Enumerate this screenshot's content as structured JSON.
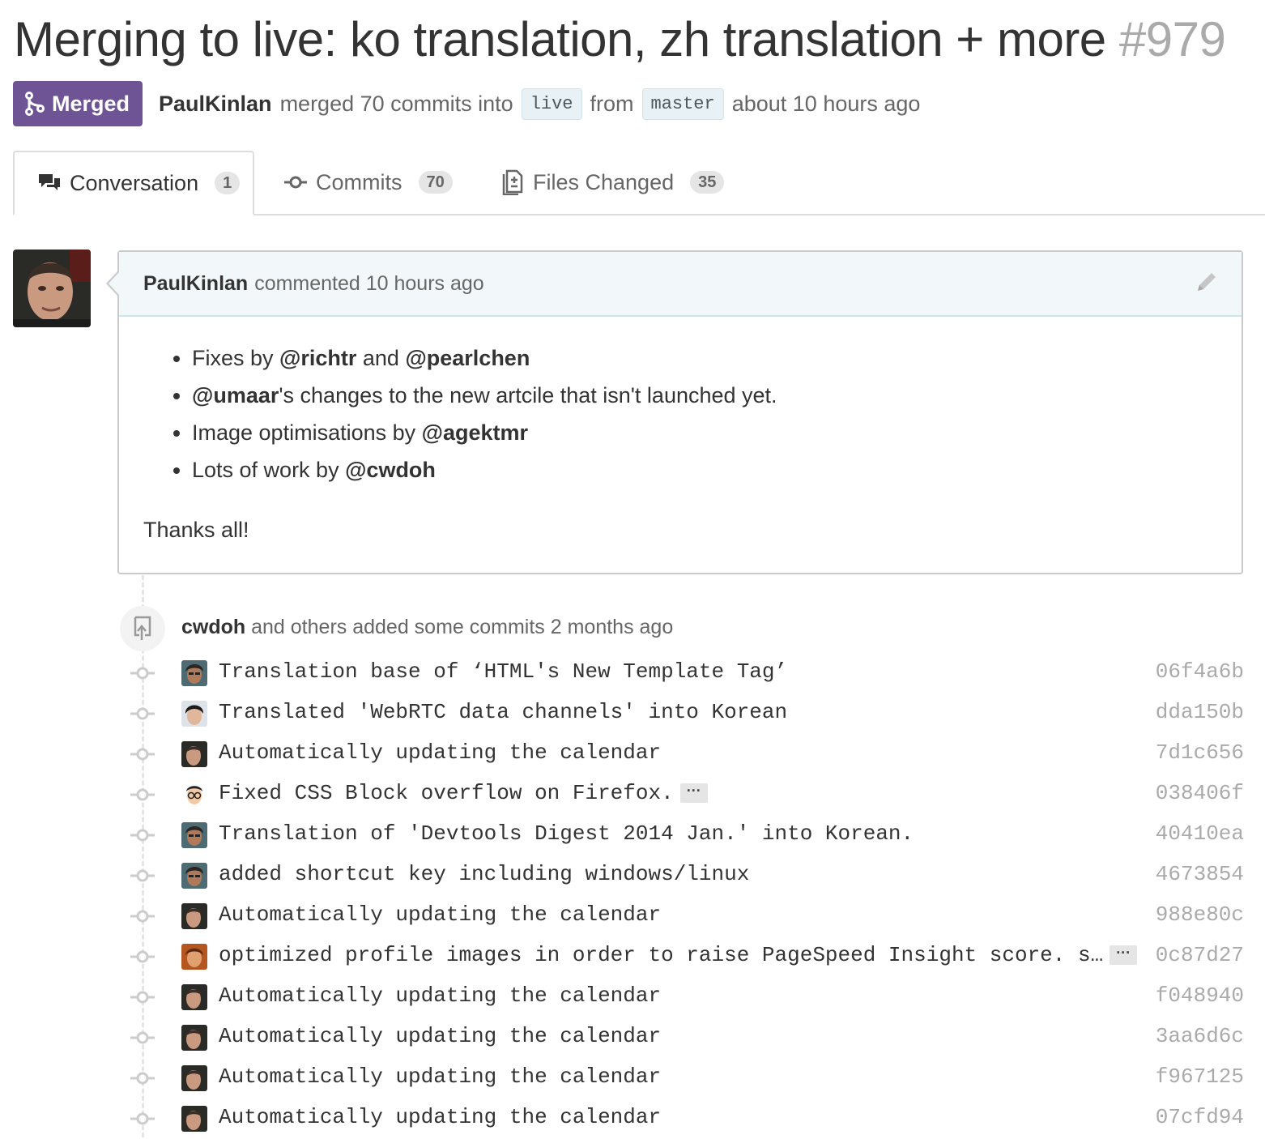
{
  "pr": {
    "title": "Merging to live: ko translation, zh translation + more",
    "number": "#979",
    "state": "Merged",
    "author": "PaulKinlan",
    "merged_text": "merged 70 commits into",
    "base_branch": "live",
    "from_text": "from",
    "head_branch": "master",
    "time": "about 10 hours ago"
  },
  "colors": {
    "merged": "#6e5494",
    "sha": "#aaaaaa",
    "header_bg": "#f2f8fa"
  },
  "tabs": [
    {
      "label": "Conversation",
      "count": "1",
      "icon": "comment-discussion-icon"
    },
    {
      "label": "Commits",
      "count": "70",
      "icon": "git-commit-icon"
    },
    {
      "label": "Files Changed",
      "count": "35",
      "icon": "diff-icon"
    }
  ],
  "comment": {
    "author": "PaulKinlan",
    "action": "commented 10 hours ago",
    "items": [
      {
        "pre": "Fixes by ",
        "m1": "@richtr",
        "mid": " and ",
        "m2": "@pearlchen"
      },
      {
        "m1": "@umaar",
        "post": "'s changes to the new artcile that isn't launched yet."
      },
      {
        "pre": "Image optimisations by ",
        "m1": "@agektmr"
      },
      {
        "pre": "Lots of work by ",
        "m1": "@cwdoh"
      }
    ],
    "closing": "Thanks all!"
  },
  "commits_header": {
    "who": "cwdoh",
    "text": "and others added some commits 2 months ago"
  },
  "commits": [
    {
      "message": "Translation base of ‘HTML's New Template Tag’",
      "sha": "06f4a6b",
      "avatar": "a"
    },
    {
      "message": "Translated 'WebRTC data channels' into Korean",
      "sha": "dda150b",
      "avatar": "b"
    },
    {
      "message": "Automatically updating the calendar",
      "sha": "7d1c656",
      "avatar": "p"
    },
    {
      "message": "Fixed CSS Block overflow on Firefox.",
      "sha": "038406f",
      "avatar": "c",
      "ellipsis": "···"
    },
    {
      "message": "Translation of 'Devtools Digest 2014 Jan.' into Korean.",
      "sha": "40410ea",
      "avatar": "a"
    },
    {
      "message": "added shortcut key including windows/linux",
      "sha": "4673854",
      "avatar": "a"
    },
    {
      "message": "Automatically updating the calendar",
      "sha": "988e80c",
      "avatar": "p"
    },
    {
      "message": "optimized profile images in order to raise PageSpeed Insight score. s…",
      "sha": "0c87d27",
      "avatar": "d",
      "ellipsis": "···"
    },
    {
      "message": "Automatically updating the calendar",
      "sha": "f048940",
      "avatar": "p"
    },
    {
      "message": "Automatically updating the calendar",
      "sha": "3aa6d6c",
      "avatar": "p"
    },
    {
      "message": "Automatically updating the calendar",
      "sha": "f967125",
      "avatar": "p"
    },
    {
      "message": "Automatically updating the calendar",
      "sha": "07cfd94",
      "avatar": "p"
    }
  ]
}
